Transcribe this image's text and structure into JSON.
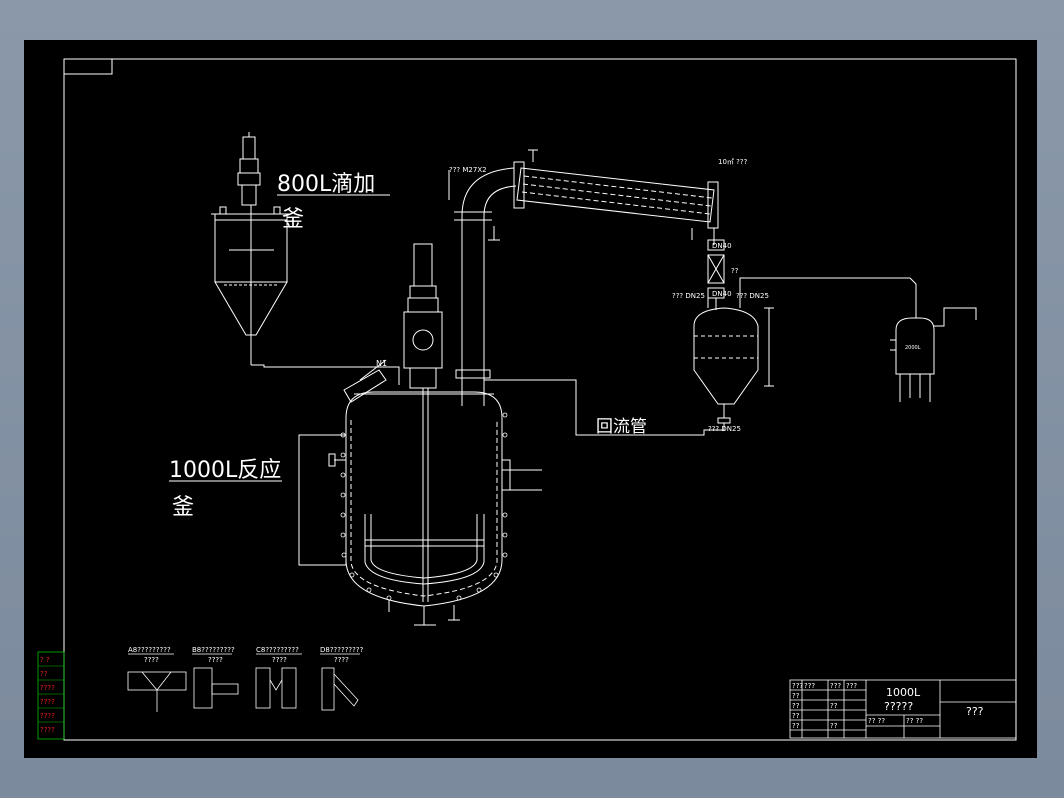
{
  "labels": {
    "dropping_kettle": "800L滴加",
    "dropping_kettle_suffix": "釜",
    "reactor": "1000L反应",
    "reactor_suffix": "釜",
    "reflux_pipe": "回流管",
    "nozzle_n1": "N1",
    "pipe_size": "??? M27X2",
    "condenser_area": "10㎡ ???",
    "dn40_top": "DN40",
    "dn40_bottom": "DN40",
    "q_mark": "??",
    "dn25_left": "??? DN25",
    "dn25_right": "??? DN25",
    "dn25_bottom": "??? DN25",
    "receiver_text": "2000L"
  },
  "detail_titles": [
    "A8?????????",
    "B8?????????",
    "C8?????????",
    "D8?????????"
  ],
  "detail_subs": [
    "????",
    "????",
    "????",
    "????"
  ],
  "title_block": {
    "name_line1": "1000L",
    "name_line2": "?????",
    "right_cell": "???",
    "revision_cells": [
      "???",
      "???",
      "???",
      "???",
      "??",
      "??",
      "??",
      "??",
      "??",
      "?? ??",
      "?? ??",
      "??"
    ]
  },
  "side_strip": [
    "? ?",
    "??",
    "????",
    "????",
    "????",
    "????"
  ],
  "colors": {
    "background": "#000000",
    "lines": "#ffffff",
    "pipes": "#ffffff",
    "accent_green": "#00c000",
    "accent_red": "#e02020",
    "window": "#8a98aa"
  }
}
